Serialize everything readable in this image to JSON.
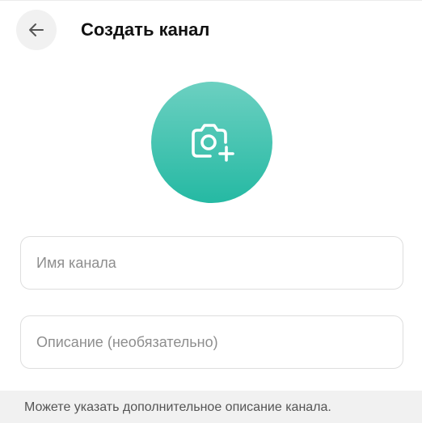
{
  "header": {
    "back_icon": "arrow-left-icon",
    "title": "Создать канал"
  },
  "avatar": {
    "icon": "camera-plus-icon",
    "gradient_top": "#6cd0c1",
    "gradient_bottom": "#25b9a3"
  },
  "form": {
    "name_placeholder": "Имя канала",
    "description_placeholder": "Описание (необязательно)"
  },
  "hint": {
    "text": "Можете указать дополнительное описание канала."
  }
}
